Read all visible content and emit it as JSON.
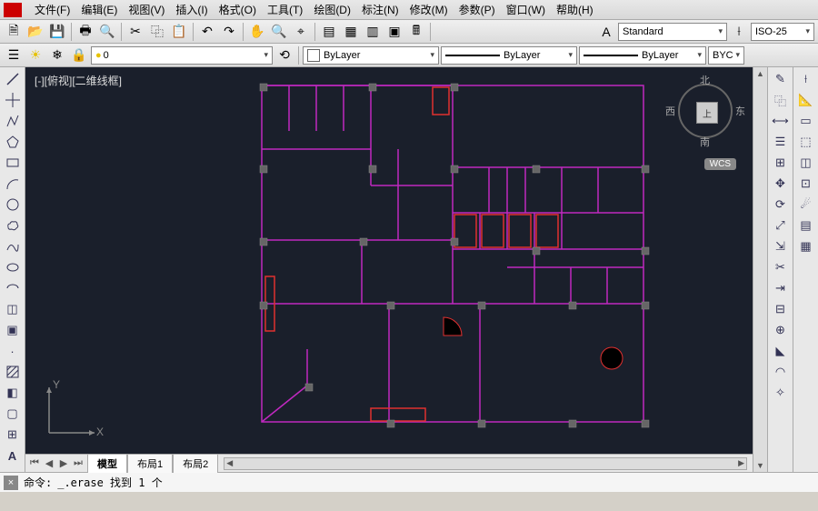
{
  "menu": [
    "文件(F)",
    "编辑(E)",
    "视图(V)",
    "插入(I)",
    "格式(O)",
    "工具(T)",
    "绘图(D)",
    "标注(N)",
    "修改(M)",
    "参数(P)",
    "窗口(W)",
    "帮助(H)"
  ],
  "toolbar1": {
    "style_dd": "Standard",
    "dim_dd": "ISO-25"
  },
  "toolbar2": {
    "layer_dd": "0",
    "color_dd": "ByLayer",
    "ltype_dd": "ByLayer",
    "lweight_dd": "ByLayer",
    "plot_dd": "BYC"
  },
  "view": {
    "label": "[-][俯视][二维线框]",
    "compass": {
      "n": "北",
      "s": "南",
      "e": "东",
      "w": "西",
      "home": "上"
    },
    "wcs": "WCS",
    "ucs": {
      "x": "X",
      "y": "Y"
    }
  },
  "tabs": {
    "items": [
      "模型",
      "布局1",
      "布局2"
    ],
    "active": 0
  },
  "command": {
    "label": "命令:",
    "text": "_.erase 找到 1 个"
  }
}
